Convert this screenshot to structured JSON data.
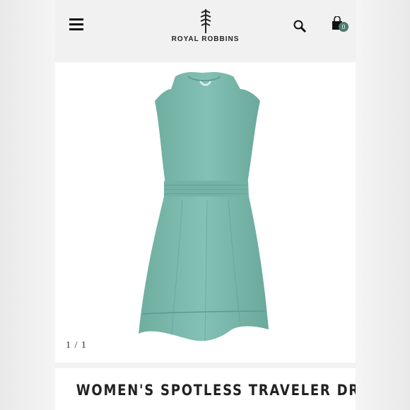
{
  "header": {
    "brand": "ROYAL ROBBINS",
    "cart_count": "0",
    "icons": [
      "menu-icon",
      "tree-logo-icon",
      "search-icon",
      "shopping-bag-icon"
    ]
  },
  "gallery": {
    "counter": "1 / 1",
    "product_color": "#7ab8ad"
  },
  "product": {
    "title": "WOMEN'S SPOTLESS TRAVELER DRESS"
  }
}
